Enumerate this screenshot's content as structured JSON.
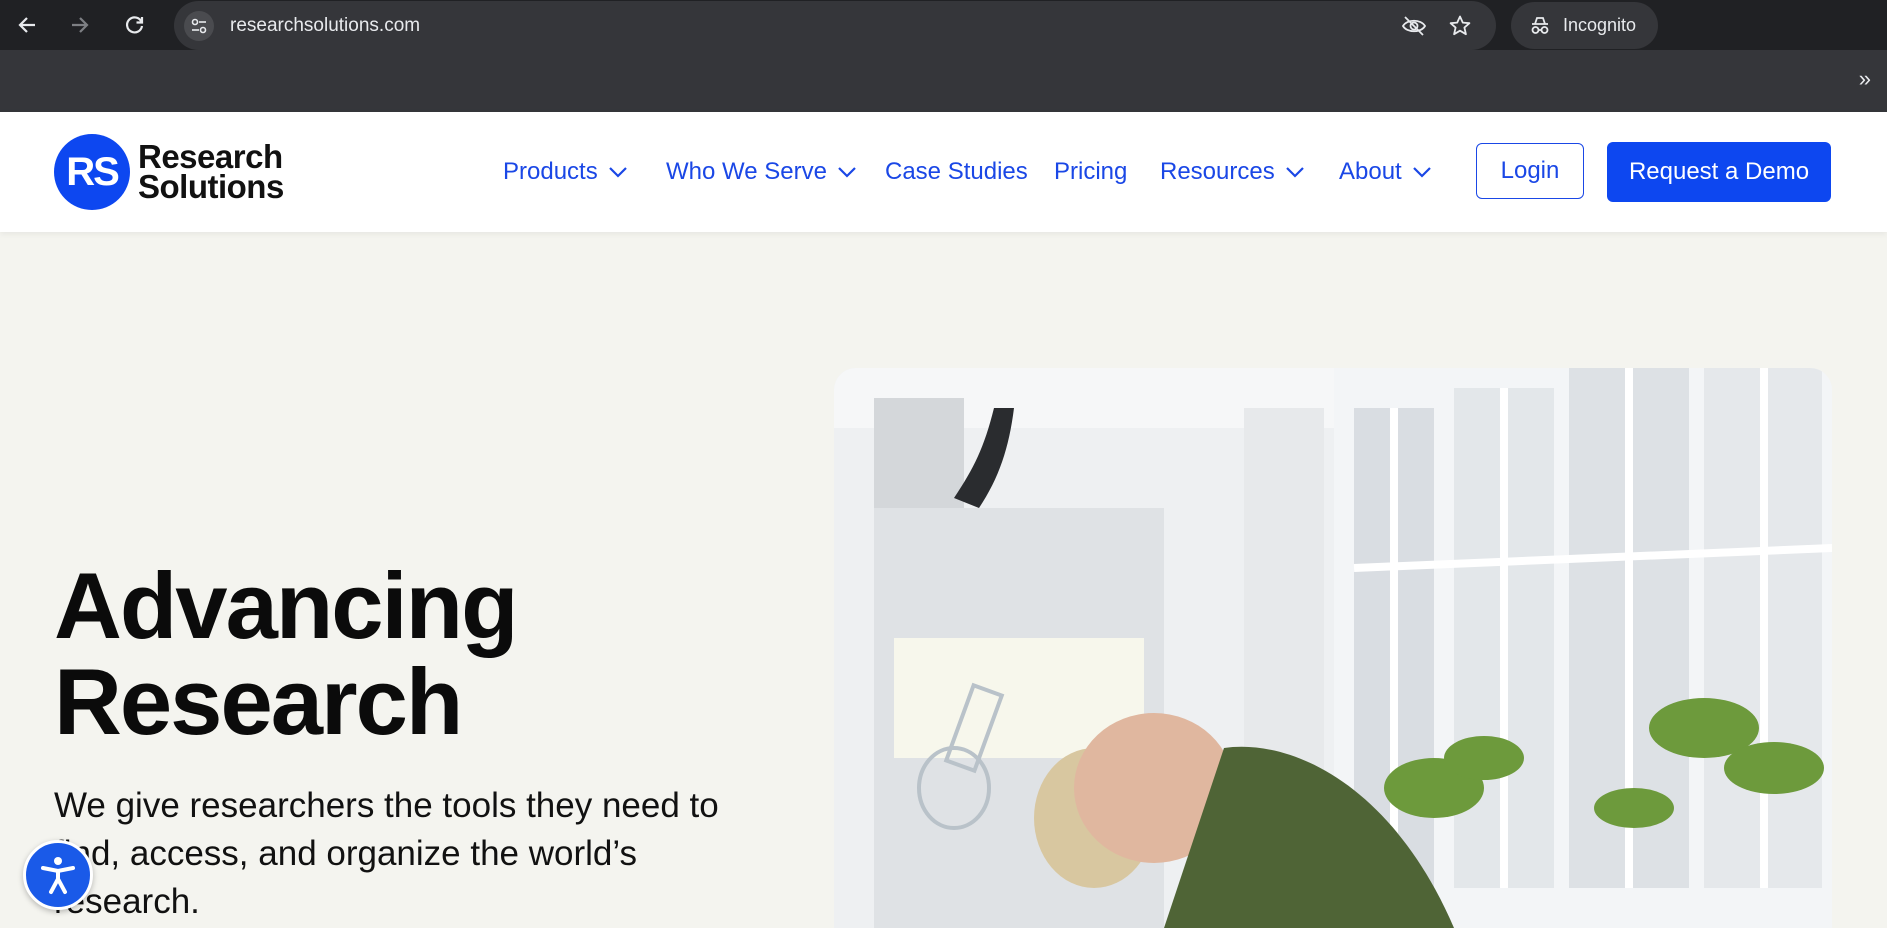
{
  "browser": {
    "url": "researchsolutions.com",
    "incognito_label": "Incognito",
    "more_label": "»"
  },
  "site": {
    "logo": {
      "mark": "RS",
      "line1": "Research",
      "line2": "Solutions"
    },
    "nav": [
      {
        "label": "Products",
        "dropdown": true
      },
      {
        "label": "Who We Serve",
        "dropdown": true
      },
      {
        "label": "Case Studies",
        "dropdown": false
      },
      {
        "label": "Pricing",
        "dropdown": false
      },
      {
        "label": "Resources",
        "dropdown": true
      },
      {
        "label": "About",
        "dropdown": true
      }
    ],
    "login_label": "Login",
    "demo_label": "Request a Demo"
  },
  "hero": {
    "title_line1": "Advancing",
    "title_line2": "Research",
    "subtitle": "We give researchers the tools they need to find, access, and organize the world’s research."
  },
  "colors": {
    "brand_blue": "#0d47f0",
    "nav_blue": "#1a47e6",
    "page_bg": "#f4f4ef"
  }
}
